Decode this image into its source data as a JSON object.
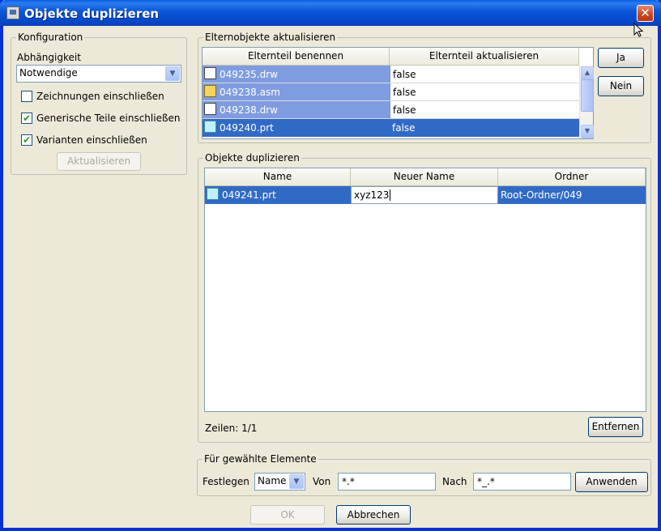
{
  "window": {
    "title": "Objekte duplizieren",
    "close_glyph": "✕"
  },
  "config": {
    "legend": "Konfiguration",
    "dependency_label": "Abhängigkeit",
    "dependency_value": "Notwendige",
    "checkboxes": [
      {
        "label": "Zeichnungen einschließen",
        "checked": false
      },
      {
        "label": "Generische Teile einschließen",
        "checked": true
      },
      {
        "label": "Varianten einschließen",
        "checked": true
      }
    ],
    "update_button": "Aktualisieren"
  },
  "parents": {
    "legend": "Elternobjekte aktualisieren",
    "columns": [
      "Elternteil benennen",
      "Elternteil aktualisieren"
    ],
    "rows": [
      {
        "name": "049235.drw",
        "icon": "drawing-icon",
        "value": "false"
      },
      {
        "name": "049238.asm",
        "icon": "assembly-icon",
        "value": "false"
      },
      {
        "name": "049238.drw",
        "icon": "drawing-icon",
        "value": "false"
      },
      {
        "name": "049240.prt",
        "icon": "part-icon",
        "value": "false"
      }
    ],
    "yes_button": "Ja",
    "no_button": "Nein"
  },
  "duplicates": {
    "legend": "Objekte duplizieren",
    "columns": [
      "Name",
      "Neuer Name",
      "Ordner"
    ],
    "rows": [
      {
        "name": "049241.prt",
        "icon": "part-icon",
        "new_name": "xyz123",
        "folder": "Root-Ordner/049"
      }
    ],
    "rows_count": "Zeilen: 1/1",
    "remove_button": "Entfernen"
  },
  "selected": {
    "legend": "Für gewählte Elemente",
    "set_label": "Festlegen",
    "set_value": "Name",
    "from_label": "Von",
    "from_value": "*.*",
    "to_label": "Nach",
    "to_value": "*_.*",
    "apply_button": "Anwenden"
  },
  "footer": {
    "ok_button": "OK",
    "cancel_button": "Abbrechen"
  },
  "colors": {
    "titlebar": "#0a55d8",
    "selection_dark": "#316ac5",
    "selection_light": "#7f9ce0",
    "dialog_bg": "#ece9d8"
  }
}
